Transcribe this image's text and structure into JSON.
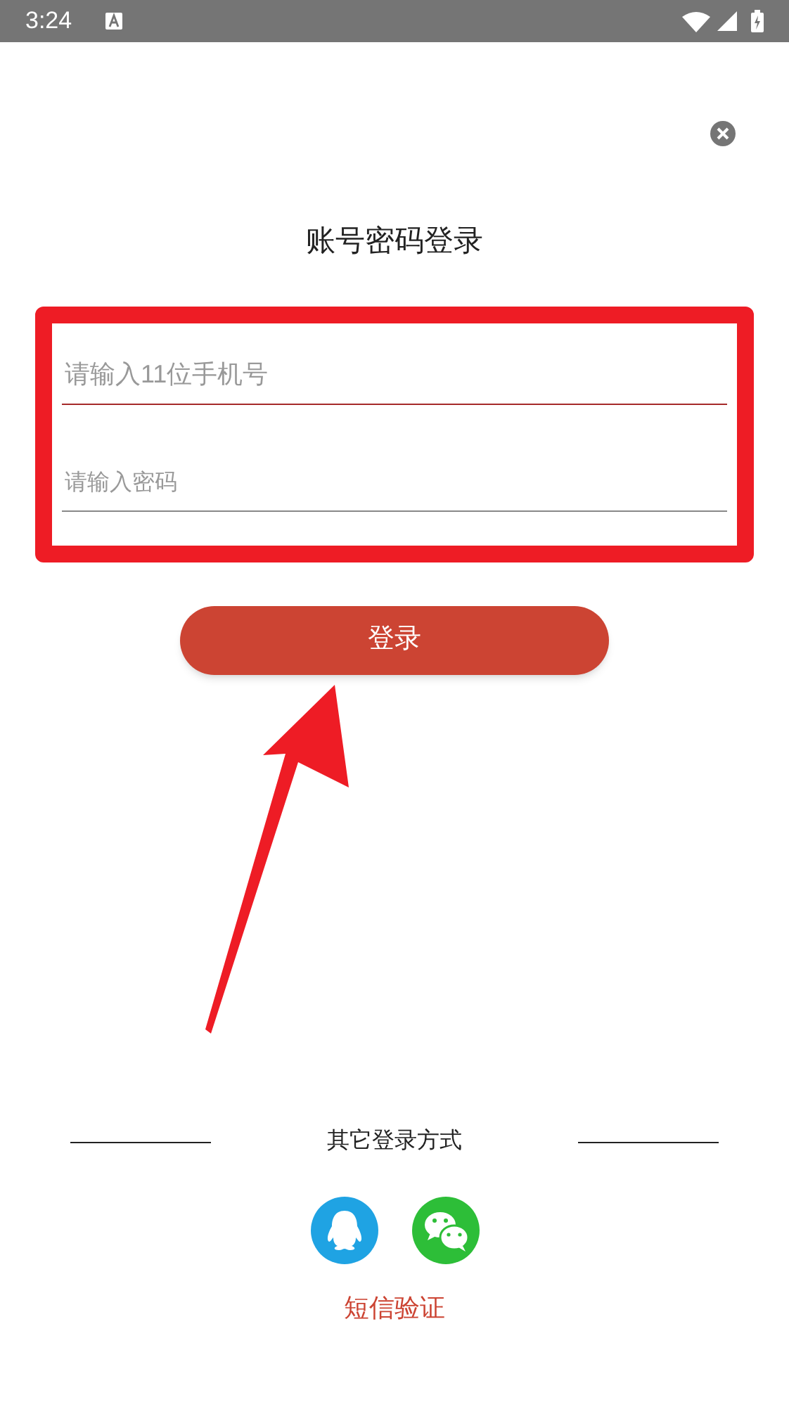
{
  "status_bar": {
    "time": "3:24"
  },
  "title": "账号密码登录",
  "fields": [
    {
      "kind": "phone",
      "placeholder": "请输入11位手机号",
      "focused": true
    },
    {
      "kind": "password",
      "placeholder": "请输入密码",
      "focused": false
    }
  ],
  "login_button": "登录",
  "other_methods": {
    "label": "其它登录方式",
    "icons": [
      {
        "kind": "qq"
      },
      {
        "kind": "wechat"
      }
    ]
  },
  "sms_link": "短信验证"
}
